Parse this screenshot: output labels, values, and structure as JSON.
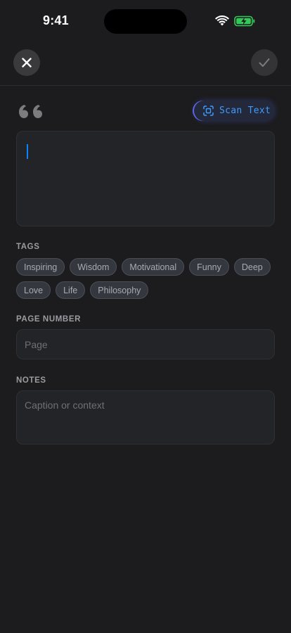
{
  "status_bar": {
    "time": "9:41",
    "icons": [
      "wifi-icon",
      "battery-charging-icon"
    ],
    "battery_color": "#34c759"
  },
  "toolbar": {
    "close_icon": "close-icon",
    "done_icon": "checkmark-icon"
  },
  "quote": {
    "icon": "quote-mark-icon",
    "scan_button_label": "Scan Text",
    "scan_icon": "scan-text-icon",
    "text_value": "",
    "accent_color": "#3f9cff"
  },
  "tags": {
    "label": "TAGS",
    "rows": [
      [
        "Inspiring",
        "Wisdom",
        "Motivational",
        "Funny",
        "Deep"
      ],
      [
        "Love",
        "Life",
        "Philosophy"
      ]
    ]
  },
  "page_number": {
    "label": "PAGE NUMBER",
    "placeholder": "Page",
    "value": ""
  },
  "notes": {
    "label": "NOTES",
    "placeholder": "Caption or context",
    "value": ""
  }
}
